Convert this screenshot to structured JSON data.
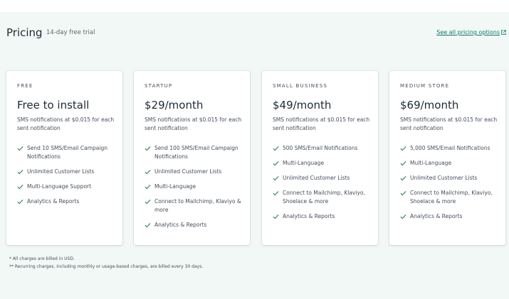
{
  "header": {
    "title": "Pricing",
    "trial": "14-day free trial",
    "see_all": "See all pricing options"
  },
  "plans": [
    {
      "label": "FREE",
      "price": "Free to install",
      "desc": "SMS notifications at $0.015 for each sent notification",
      "features": [
        "Send 10 SMS/Email Campaign Notifications",
        "Unlimited Customer Lists",
        "Multi-Language Support",
        "Analytics & Reports"
      ]
    },
    {
      "label": "STARTUP",
      "price": "$29/month",
      "desc": "SMS notifications at $0.015 for each sent notification",
      "features": [
        "Send 100 SMS/Email Campaign Notifications",
        "Unlimited Customer Lists",
        "Multi-Language",
        "Connect to Mailchimp, Klaviyo & more",
        "Analytics & Reports"
      ]
    },
    {
      "label": "SMALL BUSINESS",
      "price": "$49/month",
      "desc": "SMS notifications at $0.015 for each sent notification",
      "features": [
        "500 SMS/Email Notifications",
        "Multi-Language",
        "Unlimited Customer Lists",
        "Connect to Mailchimp, Klaviyo, Shoelace & more",
        "Analytics & Reports"
      ]
    },
    {
      "label": "MEDIUM STORE",
      "price": "$69/month",
      "desc": "SMS notifications at $0.015 for each sent notification",
      "features": [
        "5,000 SMS/Email Notifications",
        "Multi-Language",
        "Unlimited Customer Lists",
        "Connect to Mailchimp, Klaviyo, Shoelace & more",
        "Analytics & Reports"
      ]
    }
  ],
  "footnotes": [
    "* All charges are billed in USD.",
    "** Recurring charges, including monthly or usage-based charges, are billed every 30 days."
  ],
  "colors": {
    "check": "#3f8a6b",
    "link": "#0f766e",
    "panel": "#f1f8f5"
  },
  "icons": {
    "check": "check-icon",
    "external": "external-link-icon"
  }
}
